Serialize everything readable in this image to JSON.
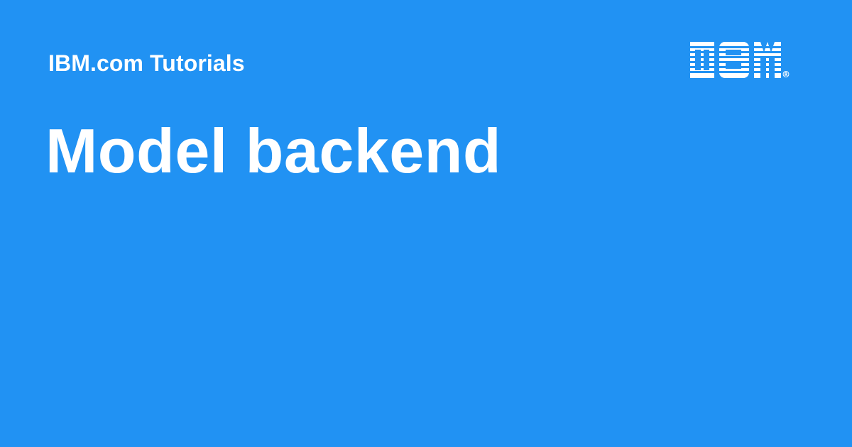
{
  "header": {
    "site_label": "IBM.com Tutorials",
    "logo": {
      "icon": "ibm-logo-icon",
      "text": "IBM",
      "mark": "®"
    }
  },
  "main": {
    "title": "Model backend"
  },
  "colors": {
    "background": "#2192f3",
    "text": "#ffffff"
  }
}
